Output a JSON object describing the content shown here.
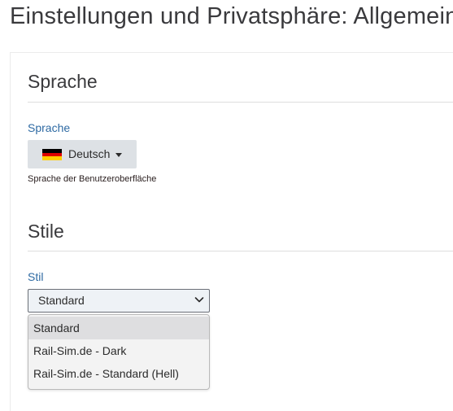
{
  "page": {
    "title": "Einstellungen und Privatsphäre: Allgemein"
  },
  "language_section": {
    "heading": "Sprache",
    "field_label": "Sprache",
    "selected_language": "Deutsch",
    "flag_icon": "germany-flag-icon",
    "flag_colors": [
      "#000000",
      "#dd0000",
      "#ffce00"
    ],
    "help_text": "Sprache der Benutzeroberfläche"
  },
  "style_section": {
    "heading": "Stile",
    "field_label": "Stil",
    "selected_value": "Standard",
    "options": [
      {
        "label": "Standard",
        "selected": true
      },
      {
        "label": "Rail-Sim.de - Dark",
        "selected": false
      },
      {
        "label": "Rail-Sim.de - Standard (Hell)",
        "selected": false
      }
    ]
  },
  "colors": {
    "label_blue": "#2e6aa3",
    "button_gray": "#dde1e5",
    "text_dark": "#3a3a3d"
  }
}
